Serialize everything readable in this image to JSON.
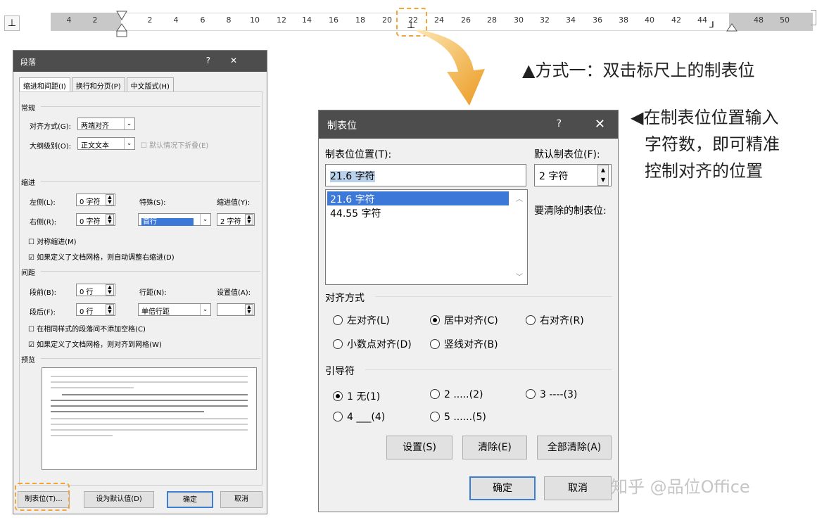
{
  "ruler": {
    "ticks": [
      "4",
      "2",
      "2",
      "4",
      "6",
      "8",
      "10",
      "12",
      "14",
      "16",
      "18",
      "20",
      "22",
      "24",
      "26",
      "28",
      "30",
      "32",
      "34",
      "36",
      "38",
      "40",
      "42",
      "44",
      "48",
      "50"
    ],
    "tab_selector_glyph": "⊥",
    "tab_stop_glyph": "⊥",
    "end_glyph": "⅃"
  },
  "annotations": {
    "method1": "▲方式一：双击标尺上的制表位",
    "note_line1": "◀在制表位位置输入",
    "note_line2": "字符数，即可精准",
    "note_line3": "控制对齐的位置"
  },
  "watermark": "知乎 @品位Office",
  "paragraph_dialog": {
    "title": "段落",
    "help": "?",
    "close": "✕",
    "tabs": [
      "缩进和间距(I)",
      "换行和分页(P)",
      "中文版式(H)"
    ],
    "section_general": "常规",
    "align_label": "对齐方式(G):",
    "align_value": "两端对齐",
    "outline_label": "大纲级别(O):",
    "outline_value": "正文文本",
    "collapse_label": "默认情况下折叠(E)",
    "section_indent": "缩进",
    "left_label": "左侧(L):",
    "left_value": "0 字符",
    "right_label": "右侧(R):",
    "right_value": "0 字符",
    "special_label": "特殊(S):",
    "special_value": "首行",
    "indent_val_label": "缩进值(Y):",
    "indent_val_value": "2 字符",
    "mirror_label": "对称缩进(M)",
    "auto_adjust_label": "如果定义了文档网格，则自动调整右缩进(D)",
    "section_spacing": "间距",
    "before_label": "段前(B):",
    "before_value": "0 行",
    "after_label": "段后(F):",
    "after_value": "0 行",
    "line_label": "行距(N):",
    "line_value": "单倍行距",
    "setval_label": "设置值(A):",
    "no_space_label": "在相同样式的段落间不添加空格(C)",
    "snap_grid_label": "如果定义了文档网格，则对齐到网格(W)",
    "section_preview": "预览",
    "btn_tabs": "制表位(T)...",
    "btn_default": "设为默认值(D)",
    "btn_ok": "确定",
    "btn_cancel": "取消"
  },
  "tab_dialog": {
    "title": "制表位",
    "help": "?",
    "close": "✕",
    "pos_label": "制表位位置(T):",
    "pos_value": "21.6 字符",
    "default_label": "默认制表位(F):",
    "default_value": "2 字符",
    "list_items": [
      "21.6 字符",
      "44.55 字符"
    ],
    "clear_label": "要清除的制表位:",
    "align_group": "对齐方式",
    "align_left": "左对齐(L)",
    "align_center": "居中对齐(C)",
    "align_right": "右对齐(R)",
    "align_decimal": "小数点对齐(D)",
    "align_bar": "竖线对齐(B)",
    "leader_group": "引导符",
    "leader_1": "1 无(1)",
    "leader_2": "2 .....(2)",
    "leader_3": "3 ----(3)",
    "leader_4": "4 ___(4)",
    "leader_5": "5 ......(5)",
    "btn_set": "设置(S)",
    "btn_clear": "清除(E)",
    "btn_clear_all": "全部清除(A)",
    "btn_ok": "确定",
    "btn_cancel": "取消"
  },
  "colors": {
    "highlight_dash": "#f2a43a",
    "arrow": "#f0a93a",
    "selection": "#3c78d8",
    "titlebar": "#4d4d4d"
  }
}
